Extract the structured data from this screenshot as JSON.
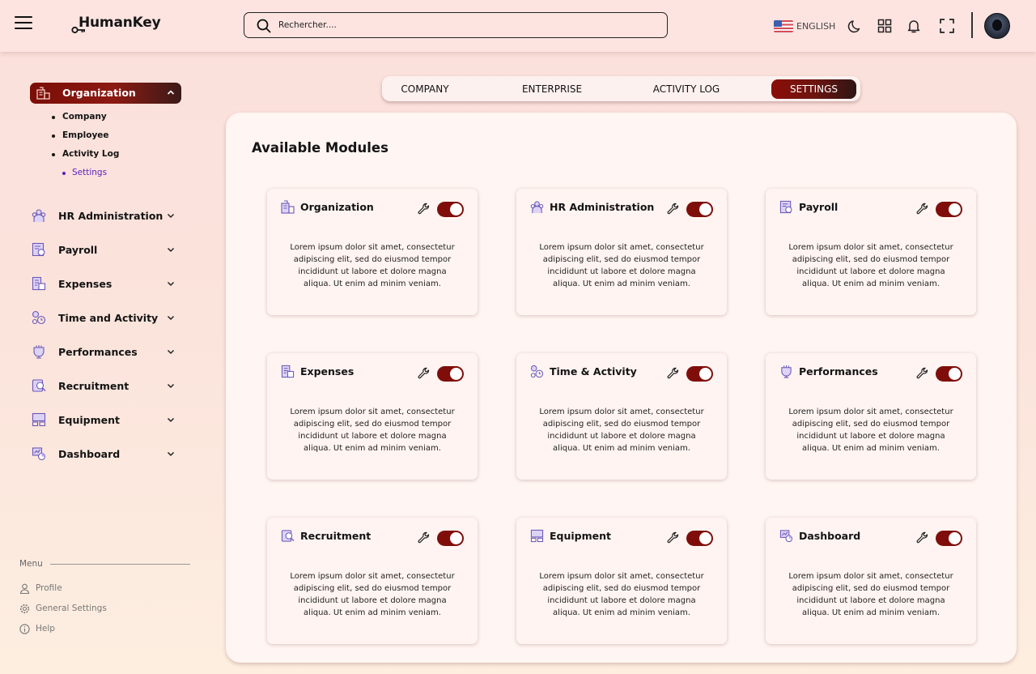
{
  "app": {
    "name": "HumanKey"
  },
  "search": {
    "placeholder": "Rechercher...."
  },
  "header": {
    "language": "ENGLISH"
  },
  "colors": {
    "accent": "#7f0e0a",
    "active_sub": "#5b1ec0",
    "background": "#fbe0dc"
  },
  "sidebar": {
    "active": {
      "label": "Organization",
      "icon": "organization-icon"
    },
    "subitems": [
      {
        "label": "Company"
      },
      {
        "label": "Employee"
      },
      {
        "label": "Activity Log"
      },
      {
        "label": "Settings",
        "active": true
      }
    ],
    "items": [
      {
        "label": "HR Administration",
        "icon": "hr-administration-icon"
      },
      {
        "label": "Payroll",
        "icon": "payroll-icon"
      },
      {
        "label": "Expenses",
        "icon": "expenses-icon"
      },
      {
        "label": "Time and Activity",
        "icon": "time-activity-icon"
      },
      {
        "label": "Performances",
        "icon": "performances-icon"
      },
      {
        "label": "Recruitment",
        "icon": "recruitment-icon"
      },
      {
        "label": "Equipment",
        "icon": "equipment-icon"
      },
      {
        "label": "Dashboard",
        "icon": "dashboard-icon"
      }
    ],
    "menu": {
      "heading": "Menu",
      "links": [
        {
          "label": "Profile",
          "icon": "user-icon"
        },
        {
          "label": "General Settings",
          "icon": "gear-icon"
        },
        {
          "label": "Help",
          "icon": "info-icon"
        }
      ]
    }
  },
  "tabs": [
    {
      "label": "COMPANY"
    },
    {
      "label": "ENTERPRISE"
    },
    {
      "label": "ACTIVITY LOG"
    },
    {
      "label": "SETTINGS",
      "active": true
    }
  ],
  "main": {
    "title": "Available Modules",
    "modules": [
      {
        "title": "Organization",
        "enabled": true,
        "description": "Lorem ipsum dolor sit amet, consectetur adipiscing elit, sed do eiusmod tempor incididunt ut labore et dolore magna aliqua. Ut enim ad minim veniam."
      },
      {
        "title": "HR Administration",
        "enabled": true,
        "description": "Lorem ipsum dolor sit amet, consectetur adipiscing elit, sed do eiusmod tempor incididunt ut labore et dolore magna aliqua. Ut enim ad minim veniam."
      },
      {
        "title": "Payroll",
        "enabled": true,
        "description": "Lorem ipsum dolor sit amet, consectetur adipiscing elit, sed do eiusmod tempor incididunt ut labore et dolore magna aliqua. Ut enim ad minim veniam."
      },
      {
        "title": "Expenses",
        "enabled": true,
        "description": "Lorem ipsum dolor sit amet, consectetur adipiscing elit, sed do eiusmod tempor incididunt ut labore et dolore magna aliqua. Ut enim ad minim veniam."
      },
      {
        "title": "Time & Activity",
        "enabled": true,
        "description": "Lorem ipsum dolor sit amet, consectetur adipiscing elit, sed do eiusmod tempor incididunt ut labore et dolore magna aliqua. Ut enim ad minim veniam."
      },
      {
        "title": "Performances",
        "enabled": true,
        "description": "Lorem ipsum dolor sit amet, consectetur adipiscing elit, sed do eiusmod tempor incididunt ut labore et dolore magna aliqua. Ut enim ad minim veniam."
      },
      {
        "title": "Recruitment",
        "enabled": true,
        "description": "Lorem ipsum dolor sit amet, consectetur adipiscing elit, sed do eiusmod tempor incididunt ut labore et dolore magna aliqua. Ut enim ad minim veniam."
      },
      {
        "title": "Equipment",
        "enabled": true,
        "description": "Lorem ipsum dolor sit amet, consectetur adipiscing elit, sed do eiusmod tempor incididunt ut labore et dolore magna aliqua. Ut enim ad minim veniam."
      },
      {
        "title": "Dashboard",
        "enabled": true,
        "description": "Lorem ipsum dolor sit amet, consectetur adipiscing elit, sed do eiusmod tempor incididunt ut labore et dolore magna aliqua. Ut enim ad minim veniam."
      }
    ]
  }
}
